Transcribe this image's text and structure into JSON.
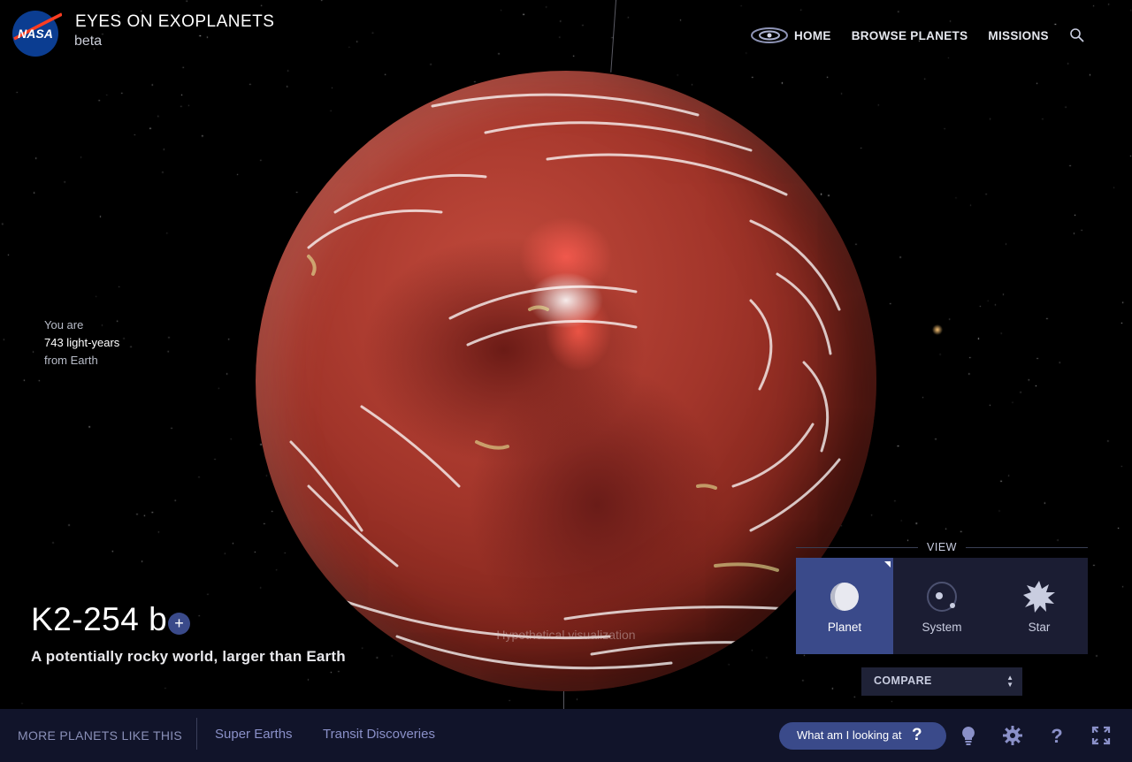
{
  "header": {
    "logo_text": "NASA",
    "title": "EYES ON EXOPLANETS",
    "subtitle": "beta"
  },
  "nav": {
    "items": [
      {
        "label": "HOME",
        "icon": "galaxy-icon"
      },
      {
        "label": "BROWSE PLANETS"
      },
      {
        "label": "MISSIONS"
      }
    ],
    "search_icon": "search-icon"
  },
  "distance": {
    "line1": "You are",
    "line2": "743 light-years",
    "line3": "from Earth"
  },
  "planet": {
    "name": "K2-254 b",
    "add_symbol": "+",
    "tagline": "A potentially rocky world, larger than Earth",
    "visualization_note": "Hypothetical visualization"
  },
  "view": {
    "label": "VIEW",
    "options": [
      {
        "label": "Planet",
        "icon": "planet-icon",
        "active": true
      },
      {
        "label": "System",
        "icon": "system-icon",
        "active": false
      },
      {
        "label": "Star",
        "icon": "star-icon",
        "active": false
      }
    ],
    "compare_label": "COMPARE"
  },
  "bottom": {
    "more_label": "MORE PLANETS LIKE THIS",
    "links": [
      "Super Earths",
      "Transit Discoveries"
    ],
    "what_label": "What am I looking at",
    "what_symbol": "?",
    "icons": [
      "lightbulb-icon",
      "settings-gear-icon",
      "help-icon",
      "fullscreen-icon"
    ]
  },
  "colors": {
    "accent": "#3a4a8a",
    "panel": "#1b1d33",
    "bar": "#11142a"
  }
}
